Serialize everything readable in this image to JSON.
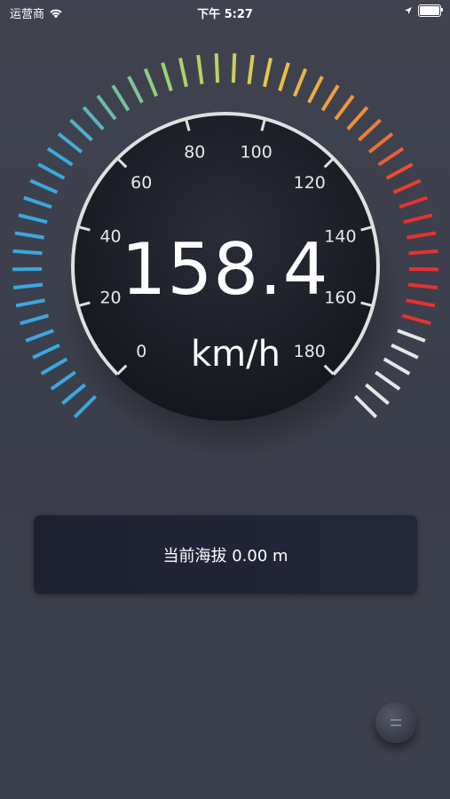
{
  "status_bar": {
    "carrier": "运营商",
    "time": "下午 5:27",
    "battery_level": 1.0
  },
  "speedometer": {
    "speed": "158.4",
    "unit": "km/h",
    "scale_min": 0,
    "scale_max": 180,
    "scale_labels": [
      "0",
      "20",
      "40",
      "60",
      "80",
      "100",
      "120",
      "140",
      "160",
      "180"
    ],
    "colors": {
      "low": "#3aa8e0",
      "mid_green": "#a8d46a",
      "mid_yellow": "#e8c84a",
      "orange": "#ee8b3a",
      "high": "#e8322e",
      "overflow": "#e6e6e6",
      "ring": "#e0e0e0"
    }
  },
  "altitude": {
    "text": "当前海拔 0.00 m"
  },
  "menu_button": {
    "icon": "menu-icon"
  }
}
